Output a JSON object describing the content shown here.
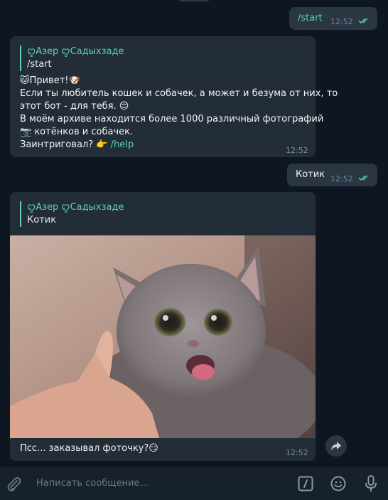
{
  "messages": {
    "out1": {
      "text": "/start",
      "time": "12:52"
    },
    "in1": {
      "reply_name": "ꨄАзер ꨄСадыхзаде",
      "reply_text": "/start",
      "lines": [
        "Привет!",
        "Если ты любитель кошек и собачек, а может и безума от них, то",
        "этот бот - для тебя.",
        "В моём архиве находится более 1000 различный фотографий",
        "котёнков и собачек.",
        "Заинтриговал?"
      ],
      "link": "/help",
      "time": "12:52"
    },
    "out2": {
      "text": "Котик",
      "time": "12:52"
    },
    "in2": {
      "reply_name": "ꨄАзер ꨄСадыхзаде",
      "reply_text": "Котик",
      "caption": "Псс... заказывал фоточку?",
      "time": "12:52"
    }
  },
  "composer": {
    "placeholder": "Написать сообщение..."
  },
  "colors": {
    "accent": "#5ecfb8",
    "bubble": "#222d38",
    "background": "#0e1621"
  },
  "icons": [
    "attach-icon",
    "bot-command-icon",
    "emoji-icon",
    "microphone-icon",
    "share-icon",
    "double-check-icon"
  ]
}
